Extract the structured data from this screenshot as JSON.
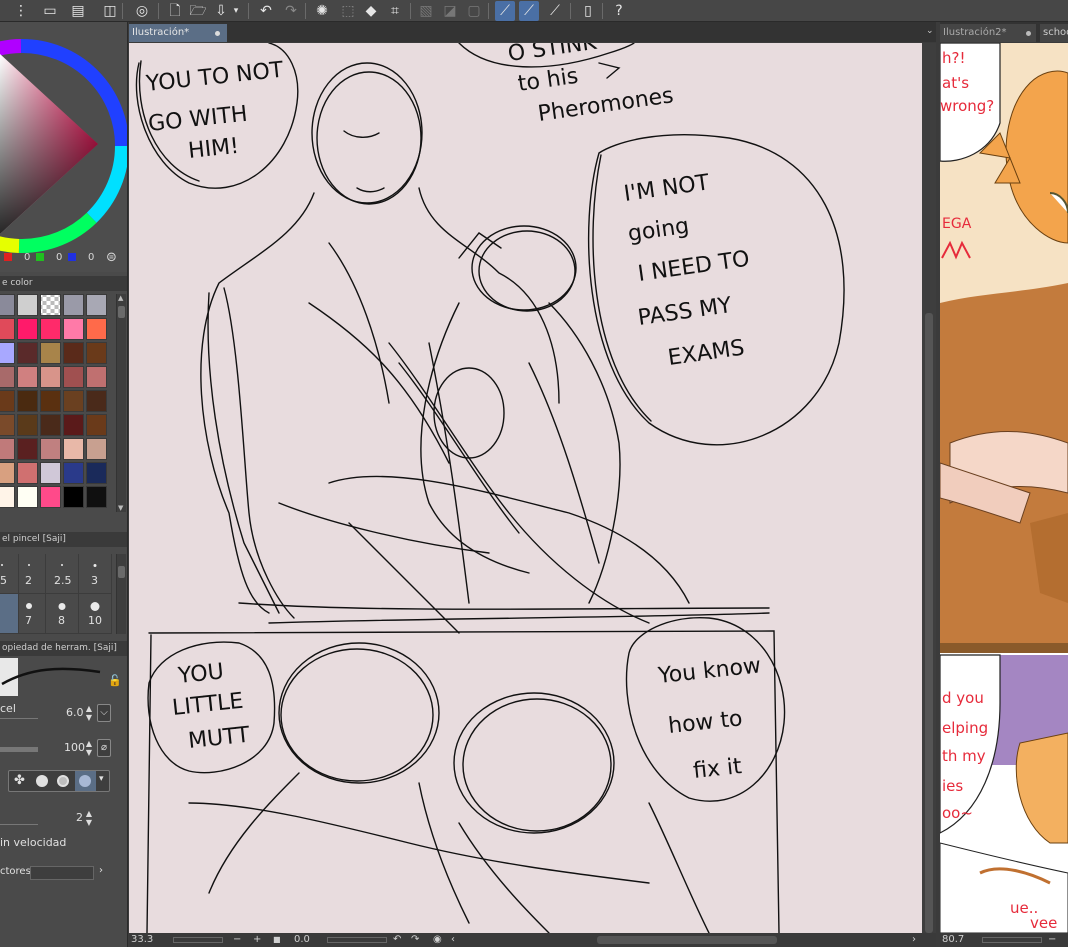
{
  "tabs": {
    "doc1": "Ilustración*",
    "doc2": "Ilustración2*",
    "doc3": "schoo"
  },
  "color_wheel": {
    "r": "0",
    "g": "0",
    "b": "0"
  },
  "panels": {
    "color_set": "e color",
    "brush_size": "el pincel [Saji]",
    "tool_property": "opiedad de herram. [Saji]"
  },
  "brush_sizes": [
    "5",
    "2",
    "2.5",
    "3",
    "",
    "7",
    "8",
    "10"
  ],
  "tool_props": {
    "brush_size_label": "cel",
    "brush_size_value": "6.0",
    "opacity_value": "100",
    "stabilization_value": "2",
    "velocity_label": "in velocidad",
    "vectors_label": "ctores"
  },
  "status": {
    "zoom1": "33.3",
    "angle1": "0.0",
    "zoom2": "80.7"
  },
  "speech": {
    "b1": [
      "YOU TO NOT",
      "GO WITH",
      "HIM!"
    ],
    "b2": [
      "O STINK",
      "to his",
      "Pheromones"
    ],
    "b3": [
      "I'M NOT",
      "going",
      "I NEED TO",
      "PASS MY",
      "EXAMS"
    ],
    "b4": [
      "YOU",
      "LITTLE",
      "MUTT"
    ],
    "b5": [
      "You know",
      "how to",
      "fix it"
    ]
  },
  "comic_text": {
    "t1": [
      "h?!",
      "at's",
      "wrong?"
    ],
    "t2": "EGA",
    "t3": [
      "d you",
      "elping",
      "th my",
      "ies",
      "oo~"
    ],
    "t4": [
      "ue..",
      "vee"
    ]
  },
  "colors": {
    "accent": "#4a6fa5",
    "canvas_bg": "#e8dcde"
  }
}
